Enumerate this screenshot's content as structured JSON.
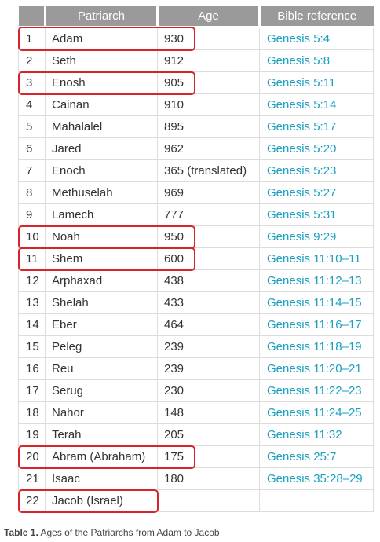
{
  "headers": {
    "num": "",
    "patriarch": "Patriarch",
    "age": "Age",
    "reference": "Bible reference"
  },
  "rows": [
    {
      "num": "1",
      "name": "Adam",
      "age": "930",
      "ref": "Genesis 5:4",
      "highlighted": true
    },
    {
      "num": "2",
      "name": "Seth",
      "age": "912",
      "ref": "Genesis 5:8",
      "highlighted": false
    },
    {
      "num": "3",
      "name": "Enosh",
      "age": "905",
      "ref": "Genesis 5:11",
      "highlighted": true
    },
    {
      "num": "4",
      "name": "Cainan",
      "age": "910",
      "ref": "Genesis 5:14",
      "highlighted": false
    },
    {
      "num": "5",
      "name": "Mahalalel",
      "age": "895",
      "ref": "Genesis 5:17",
      "highlighted": false
    },
    {
      "num": "6",
      "name": "Jared",
      "age": "962",
      "ref": "Genesis 5:20",
      "highlighted": false
    },
    {
      "num": "7",
      "name": "Enoch",
      "age": "365 (translated)",
      "ref": "Genesis 5:23",
      "highlighted": false
    },
    {
      "num": "8",
      "name": "Methuselah",
      "age": "969",
      "ref": "Genesis 5:27",
      "highlighted": false
    },
    {
      "num": "9",
      "name": "Lamech",
      "age": "777",
      "ref": "Genesis 5:31",
      "highlighted": false
    },
    {
      "num": "10",
      "name": "Noah",
      "age": "950",
      "ref": "Genesis 9:29",
      "highlighted": true
    },
    {
      "num": "11",
      "name": "Shem",
      "age": "600",
      "ref": "Genesis 11:10–11",
      "highlighted": true
    },
    {
      "num": "12",
      "name": "Arphaxad",
      "age": "438",
      "ref": "Genesis 11:12–13",
      "highlighted": false
    },
    {
      "num": "13",
      "name": "Shelah",
      "age": "433",
      "ref": "Genesis 11:14–15",
      "highlighted": false
    },
    {
      "num": "14",
      "name": "Eber",
      "age": "464",
      "ref": "Genesis 11:16–17",
      "highlighted": false
    },
    {
      "num": "15",
      "name": "Peleg",
      "age": "239",
      "ref": "Genesis 11:18–19",
      "highlighted": false
    },
    {
      "num": "16",
      "name": "Reu",
      "age": "239",
      "ref": "Genesis 11:20–21",
      "highlighted": false
    },
    {
      "num": "17",
      "name": "Serug",
      "age": "230",
      "ref": "Genesis 11:22–23",
      "highlighted": false
    },
    {
      "num": "18",
      "name": "Nahor",
      "age": "148",
      "ref": "Genesis 11:24–25",
      "highlighted": false
    },
    {
      "num": "19",
      "name": "Terah",
      "age": "205",
      "ref": "Genesis 11:32",
      "highlighted": false
    },
    {
      "num": "20",
      "name": "Abram (Abraham)",
      "age": "175",
      "ref": "Genesis 25:7",
      "highlighted": true
    },
    {
      "num": "21",
      "name": "Isaac",
      "age": "180",
      "ref": "Genesis 35:28–29",
      "highlighted": false
    },
    {
      "num": "22",
      "name": "Jacob (Israel)",
      "age": "",
      "ref": "",
      "highlighted": true
    }
  ],
  "caption": {
    "label": "Table 1.",
    "text": " Ages of the Patriarchs from Adam to Jacob"
  },
  "colors": {
    "header_bg": "#9a9a9a",
    "link": "#1a9fc0",
    "highlight_border": "#d8232a",
    "grid": "#dddddd"
  }
}
